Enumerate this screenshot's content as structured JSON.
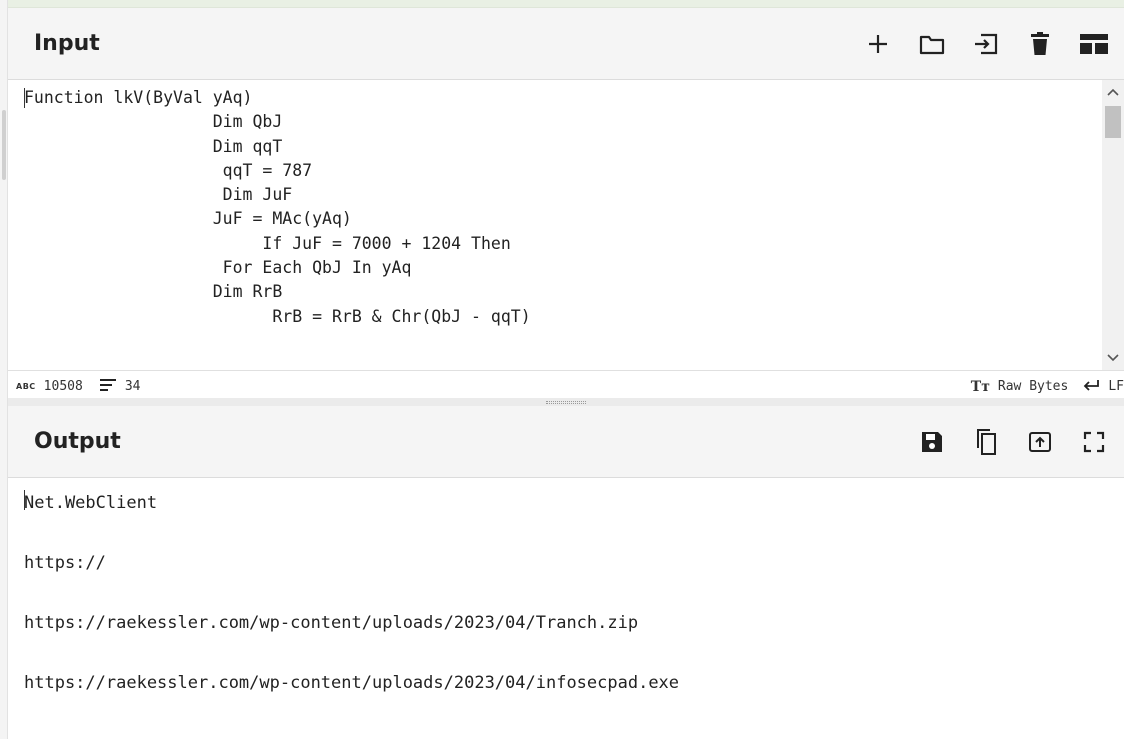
{
  "input": {
    "title": "Input",
    "code_lines": [
      "Function lkV(ByVal yAq)",
      "                   Dim QbJ",
      "                   Dim qqT",
      "                    qqT = 787",
      "                    Dim JuF",
      "                   JuF = MAc(yAq)",
      "                        If JuF = 7000 + 1204 Then",
      "                    For Each QbJ In yAq",
      "                   Dim RrB",
      "                         RrB = RrB & Chr(QbJ - qqT)"
    ],
    "icons": [
      "plus-icon",
      "folder-icon",
      "import-icon",
      "trash-icon",
      "layout-icon"
    ]
  },
  "status": {
    "abc_label": "ABC",
    "length": "10508",
    "lines": "34",
    "encoding": "Raw Bytes",
    "eol": "LF"
  },
  "output": {
    "title": "Output",
    "lines": [
      "Net.WebClient",
      "",
      "https://",
      "",
      "https://raekessler.com/wp-content/uploads/2023/04/Tranch.zip",
      "",
      "https://raekessler.com/wp-content/uploads/2023/04/infosecpad.exe"
    ],
    "icons": [
      "save-icon",
      "copy-icon",
      "replace-input-icon",
      "maximize-icon"
    ]
  }
}
